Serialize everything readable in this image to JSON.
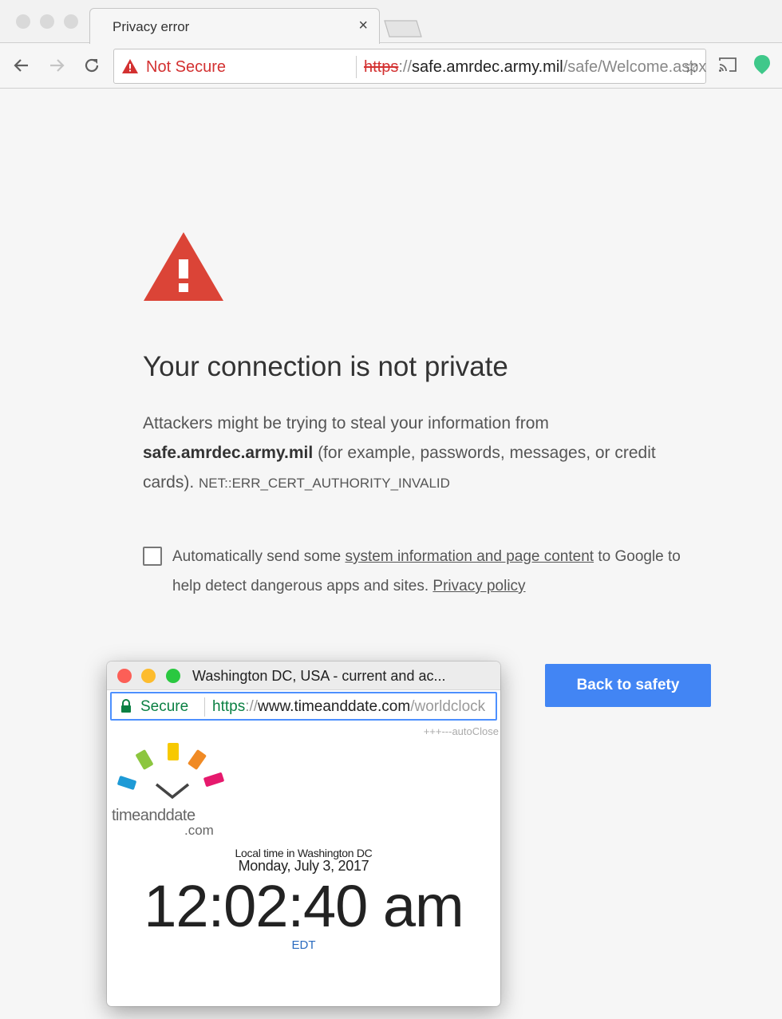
{
  "browser": {
    "tab_title": "Privacy error",
    "tab_close": "×",
    "security_label": "Not Secure",
    "url": {
      "scheme": "https",
      "separator": "://",
      "host": "safe.amrdec.army.mil",
      "path": "/safe/Welcome.aspx"
    },
    "icons": [
      "back-icon",
      "forward-icon",
      "reload-icon",
      "warning-icon",
      "star-icon",
      "cast-icon",
      "extension-icon"
    ],
    "colors": {
      "not_secure": "#d33131",
      "secure": "#0b8043"
    }
  },
  "interstitial": {
    "heading": "Your connection is not private",
    "body_prefix": "Attackers might be trying to steal your information from ",
    "body_host": "safe.amrdec.army.mil",
    "body_suffix": " (for example, passwords, messages, or credit cards). ",
    "error_code": "NET::ERR_CERT_AUTHORITY_INVALID",
    "optin_prefix": "Automatically send some ",
    "optin_link": "system information and page content",
    "optin_middle": " to Google to help detect dangerous apps and sites. ",
    "privacy_link": "Privacy policy",
    "back_button": "Back to safety",
    "colors": {
      "warning_red": "#db4437",
      "button_blue": "#4285f4"
    }
  },
  "popup": {
    "title": "Washington DC, USA - current and ac...",
    "security_label": "Secure",
    "url": {
      "scheme": "https",
      "separator": "://",
      "host": "www.timeanddate.com",
      "path": "/worldclock"
    },
    "autoclose": "+++---autoClose",
    "logo_name": "timeanddate",
    "logo_suffix": ".com",
    "local_time_label": "Local time in Washington DC",
    "date": "Monday, July 3, 2017",
    "time": "12:02:40 am",
    "timezone": "EDT"
  }
}
